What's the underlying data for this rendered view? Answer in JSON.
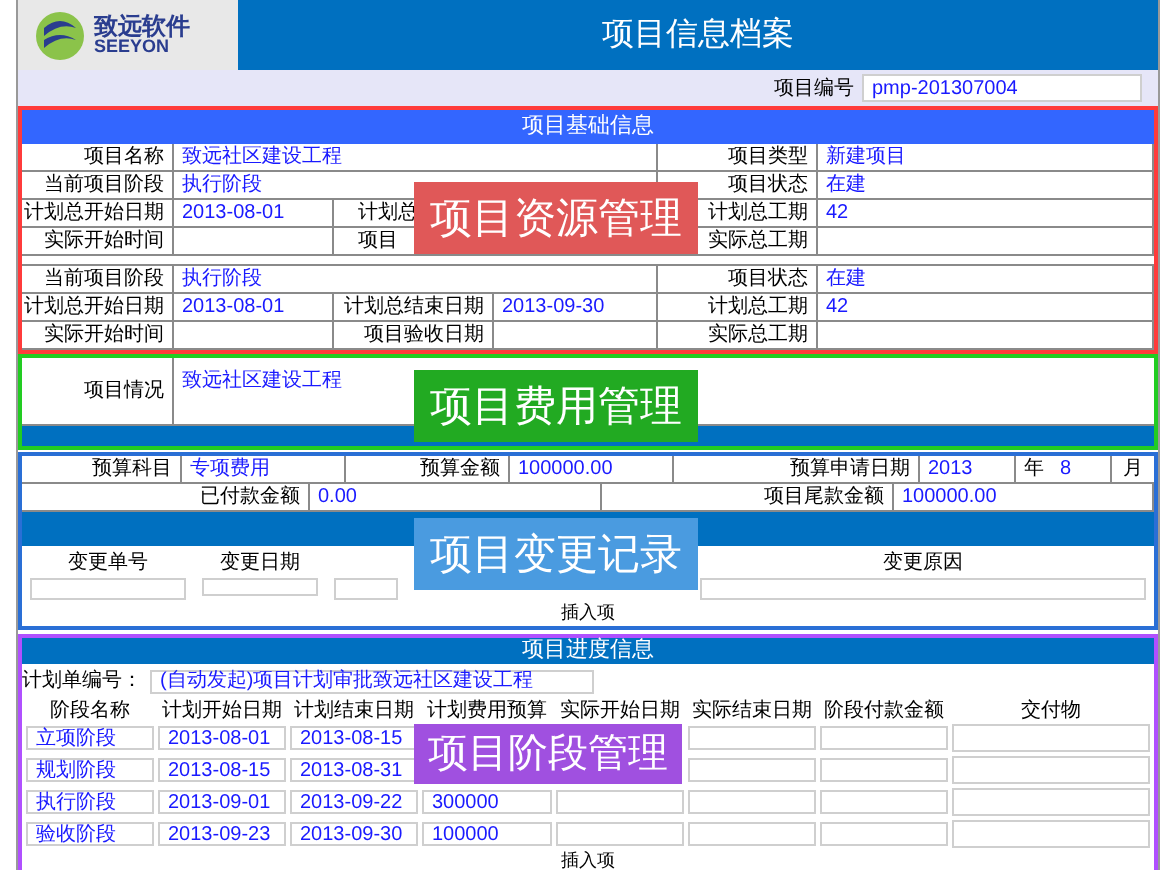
{
  "header": {
    "logo_name": "致远软件",
    "logo_latin": "SEEYON",
    "title": "项目信息档案"
  },
  "project_no": {
    "label": "项目编号",
    "value": "pmp-201307004"
  },
  "basic": {
    "title": "项目基础信息",
    "overlay": "项目资源管理",
    "rows": [
      {
        "kind": "wide",
        "cells": [
          {
            "label": "项目名称",
            "value": "致远社区建设工程"
          },
          {
            "label": "项目类型",
            "value": "新建项目"
          }
        ]
      },
      {
        "kind": "wide",
        "cells": [
          {
            "label": "当前项目阶段",
            "value": "执行阶段"
          },
          {
            "label": "项目状态",
            "value": "在建"
          }
        ]
      },
      {
        "kind": "triple",
        "cells": [
          {
            "label": "计划总开始日期",
            "value": "2013-08-01"
          },
          {
            "label": "计划总",
            "cut": true
          },
          {
            "label": "计划总工期",
            "value": "42"
          }
        ]
      },
      {
        "kind": "triple",
        "cells": [
          {
            "label": "实际开始时间"
          },
          {
            "label": "项目",
            "cut": true
          },
          {
            "label": "实际总工期"
          }
        ]
      },
      {
        "kind": "sliver"
      },
      {
        "kind": "wide",
        "cells": [
          {
            "label": "当前项目阶段",
            "value": "执行阶段"
          },
          {
            "label": "项目状态",
            "value": "在建"
          }
        ]
      },
      {
        "kind": "triple",
        "cells": [
          {
            "label": "计划总开始日期",
            "value": "2013-08-01"
          },
          {
            "label": "计划总结束日期",
            "value": "2013-09-30"
          },
          {
            "label": "计划总工期",
            "value": "42"
          }
        ]
      },
      {
        "kind": "triple",
        "cells": [
          {
            "label": "实际开始时间"
          },
          {
            "label": "项目验收日期"
          },
          {
            "label": "实际总工期"
          }
        ]
      }
    ]
  },
  "situation": {
    "label": "项目情况",
    "value": "致远社区建设工程",
    "overlay": "项目费用管理"
  },
  "budget": {
    "overlay": "项目变更记录",
    "subject": {
      "label": "预算科目",
      "value": "专项费用"
    },
    "amount": {
      "label": "预算金额",
      "value": "100000.00"
    },
    "apply_date": {
      "label": "预算申请日期",
      "year": "2013",
      "year_unit": "年",
      "month": "8",
      "month_unit": "月"
    },
    "paid": {
      "label": "已付款金额",
      "value": "0.00"
    },
    "balance": {
      "label": "项目尾款金额",
      "value": "100000.00"
    },
    "change_columns": [
      {
        "label": "变更单号"
      },
      {
        "label": "变更日期"
      },
      {
        "kind": "covered"
      },
      {
        "label": "变更原因"
      }
    ],
    "insert": "插入项"
  },
  "progress": {
    "title": "项目进度信息",
    "overlay": "项目阶段管理",
    "plan_label": "计划单编号：",
    "plan_value": "(自动发起)项目计划审批致远社区建设工程",
    "columns": [
      "阶段名称",
      "计划开始日期",
      "计划结束日期",
      "计划费用预算",
      "实际开始日期",
      "实际结束日期",
      "阶段付款金额",
      "交付物"
    ],
    "rows": [
      {
        "name": "立项阶段",
        "plan_start": "2013-08-01",
        "plan_end": "2013-08-15"
      },
      {
        "name": "规划阶段",
        "plan_start": "2013-08-15",
        "plan_end": "2013-08-31"
      },
      {
        "name": "执行阶段",
        "plan_start": "2013-09-01",
        "plan_end": "2013-09-22",
        "budget": "300000"
      },
      {
        "name": "验收阶段",
        "plan_start": "2013-09-23",
        "plan_end": "2013-09-30",
        "budget": "100000"
      }
    ],
    "insert": "插入项"
  }
}
